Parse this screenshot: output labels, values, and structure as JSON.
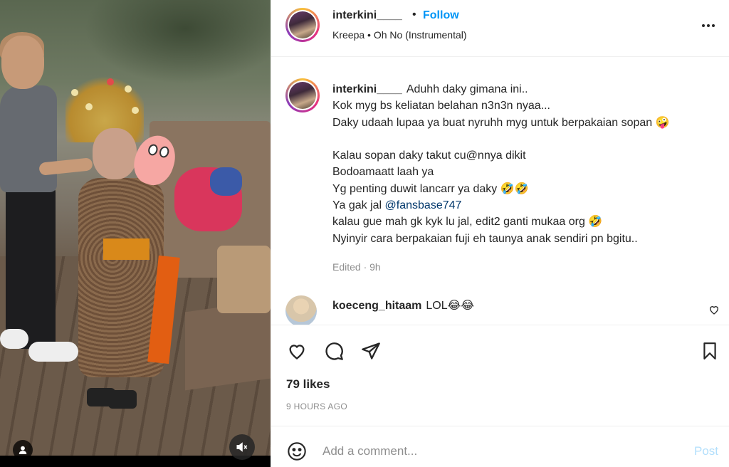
{
  "post": {
    "username": "interkini____",
    "follow_label": "Follow",
    "separator": "•",
    "music": "Kreepa • Oh No (Instrumental)"
  },
  "caption": {
    "username": "interkini____",
    "lines": [
      "Aduhh daky gimana ini..",
      "Kok myg bs keliatan belahan n3n3n nyaa...",
      "Daky udaah lupaa ya buat nyruhh myg untuk berpakaian sopan 🤪",
      "",
      "Kalau sopan daky takut cu@nnya dikit",
      "Bodoamaatt laah ya",
      "Yg penting duwit lancarr ya daky 🤣🤣",
      "Ya gak jal",
      "kalau gue mah gk kyk lu jal, edit2 ganti mukaa org 🤣",
      "Nyinyir cara berpakaian fuji eh taunya anak sendiri pn bgitu.."
    ],
    "mention": "@fansbase747",
    "edited": "Edited · 9h"
  },
  "comment": {
    "username": "koeceng_hitaam",
    "text": "LOL😂😂"
  },
  "likes": "79 likes",
  "timestamp": "9 HOURS AGO",
  "add_comment": {
    "placeholder": "Add a comment...",
    "post_label": "Post"
  },
  "colors": {
    "accent": "#0095f6",
    "mention": "#00376b",
    "muted": "#8e8e8e",
    "post_disabled": "#b2dffc"
  },
  "icons": [
    "user-tag-icon",
    "mute-icon",
    "more-icon",
    "heart-icon",
    "comment-icon",
    "share-icon",
    "bookmark-icon",
    "emoji-icon"
  ]
}
